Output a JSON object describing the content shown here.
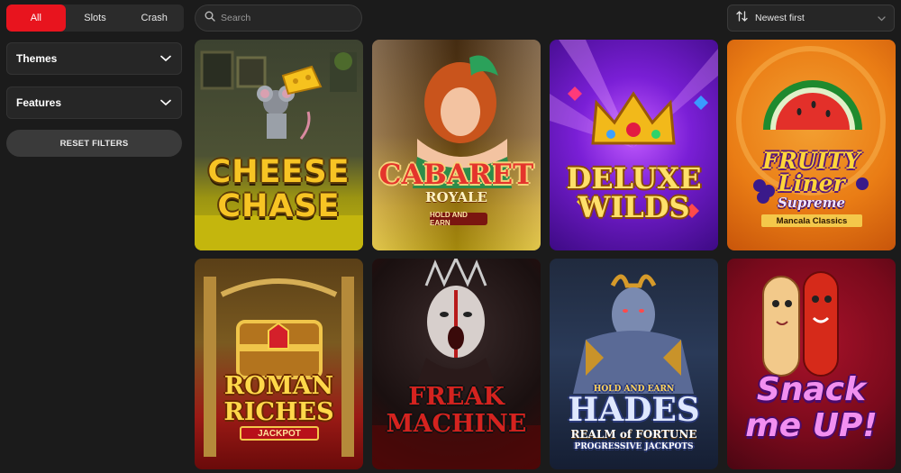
{
  "filters": {
    "tabs": [
      {
        "label": "All",
        "active": true
      },
      {
        "label": "Slots",
        "active": false
      },
      {
        "label": "Crash",
        "active": false
      }
    ],
    "themes_label": "Themes",
    "features_label": "Features",
    "reset_label": "RESET FILTERS"
  },
  "search": {
    "placeholder": "Search",
    "icon": "search-icon"
  },
  "sort": {
    "selected": "Newest first",
    "icon": "sort-arrows-icon"
  },
  "colors": {
    "accent": "#e8141e",
    "background": "#1b1b1b"
  },
  "games": [
    {
      "title_line1": "CHEESE",
      "title_line2": "CHASE"
    },
    {
      "title": "CABARET",
      "subtitle": "ROYALE",
      "badge": "HOLD AND EARN"
    },
    {
      "title_line1": "DELUXE",
      "title_line2": "WILDS"
    },
    {
      "title_line1": "FRUITY",
      "title_line2": "Liner",
      "subtitle": "Supreme",
      "tag": "Mancala Classics"
    },
    {
      "title_line1": "ROMAN",
      "title_line2": "RICHES",
      "badge": "JACKPOT"
    },
    {
      "title_line1": "FREAK",
      "title_line2": "MACHINE"
    },
    {
      "top": "HOLD AND EARN",
      "title": "HADES",
      "subtitle": "REALM of FORTUNE",
      "bottom": "PROGRESSIVE JACKPOTS"
    },
    {
      "title_line1": "Snack",
      "title_line2": "me UP!"
    }
  ]
}
